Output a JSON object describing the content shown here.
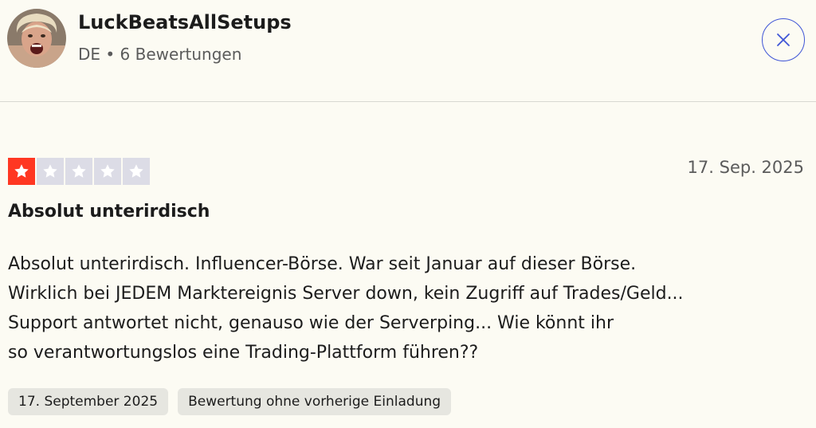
{
  "user": {
    "name": "LuckBeatsAllSetups",
    "meta": "DE • 6 Bewertungen"
  },
  "review": {
    "rating": 1,
    "rating_max": 5,
    "date": "17. Sep. 2025",
    "title": "Absolut unterirdisch",
    "body_lines": [
      "Absolut unterirdisch. Influencer-Börse. War seit Januar auf dieser Börse.",
      "Wirklich bei JEDEM Marktereignis Server down, kein Zugriff auf Trades/Geld...",
      "Support antwortet nicht, genauso wie der Serverping... Wie könnt ihr",
      "so verantwortungslos eine Trading-Plattform führen??"
    ],
    "tags": [
      "17. September 2025",
      "Bewertung ohne vorherige Einladung"
    ]
  },
  "colors": {
    "background": "#fcfbf3",
    "star_filled": "#ff3722",
    "star_empty": "#dcdce6",
    "close_accent": "#3f55d6"
  },
  "icons": {
    "close": "close-icon",
    "star": "star-icon"
  }
}
